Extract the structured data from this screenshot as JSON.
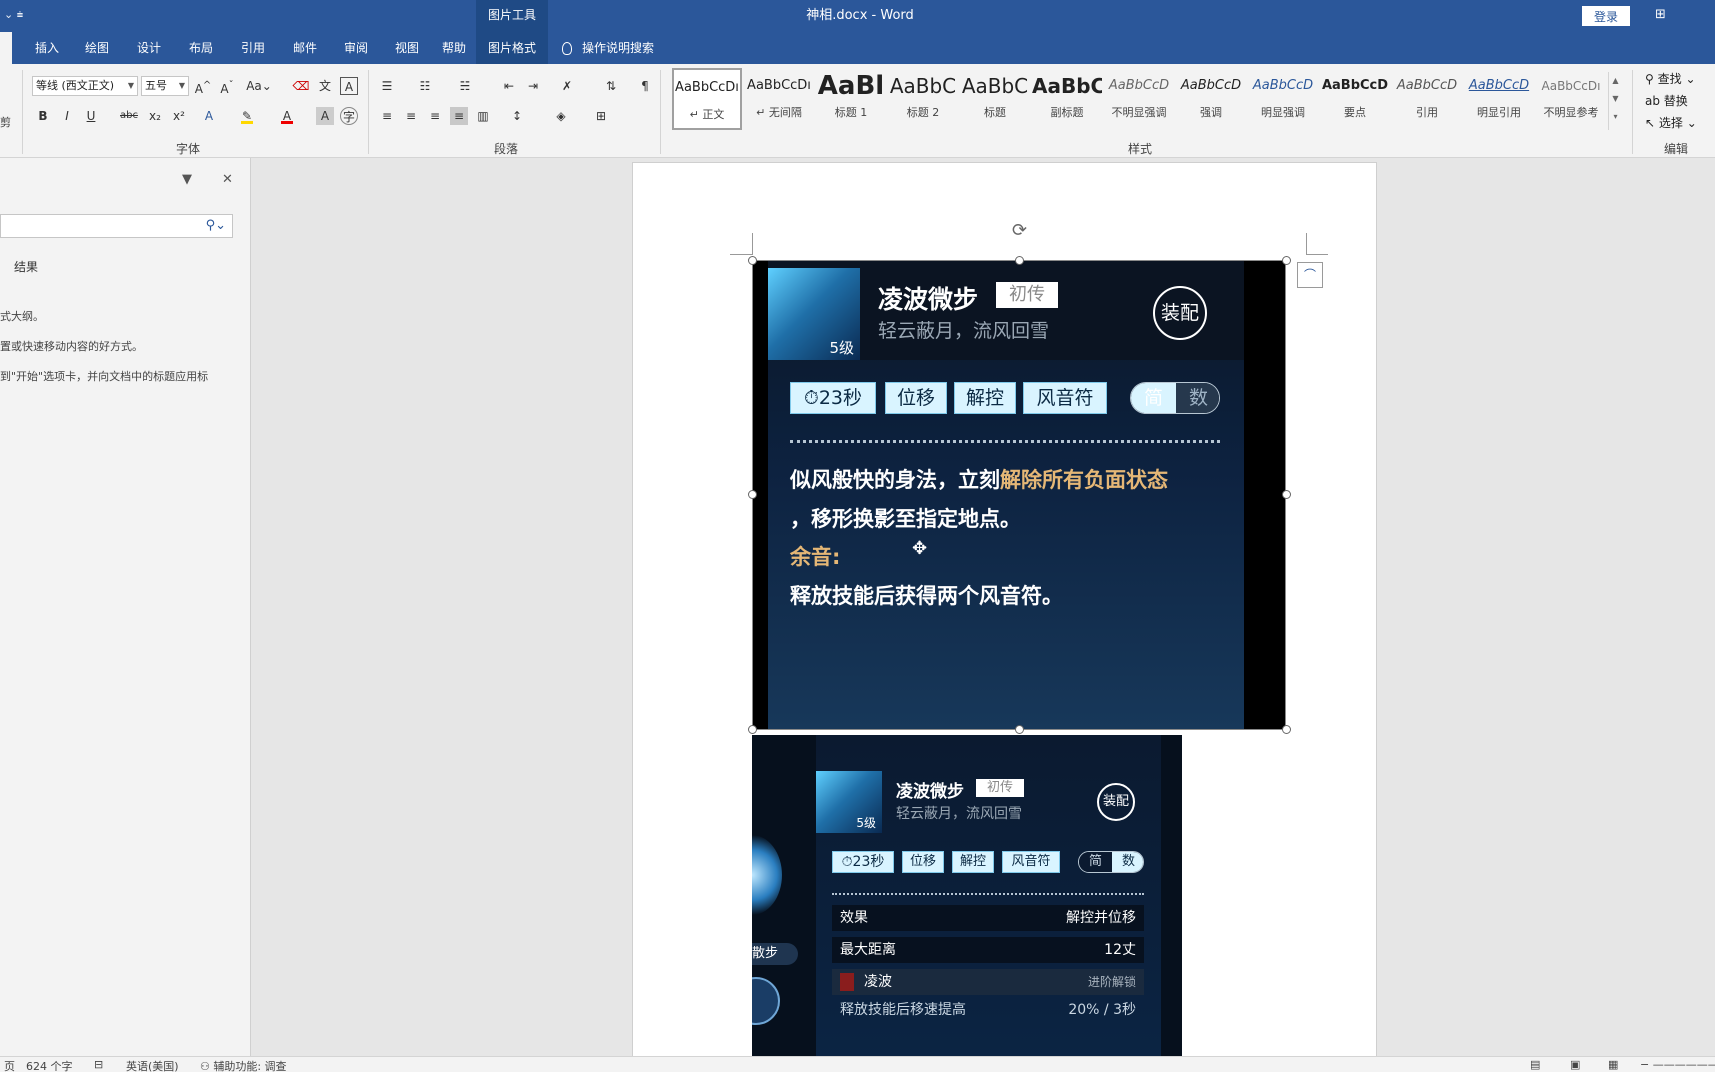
{
  "titlebar": {
    "qat": "⌄  ⩧",
    "context_tools": "图片工具",
    "doc_title": "神相.docx  -  Word",
    "login": "登录",
    "ribbon_display": "⊞"
  },
  "tabs": [
    {
      "label": "插入"
    },
    {
      "label": "绘图"
    },
    {
      "label": "设计"
    },
    {
      "label": "布局"
    },
    {
      "label": "引用"
    },
    {
      "label": "邮件"
    },
    {
      "label": "审阅"
    },
    {
      "label": "视图"
    },
    {
      "label": "帮助"
    },
    {
      "label": "图片格式"
    }
  ],
  "tell_me": "操作说明搜索",
  "ribbon": {
    "clipboard_tail": "剪",
    "font_name": "等线 (西文正文)",
    "font_size": "五号",
    "group_font": "字体",
    "group_paragraph": "段落",
    "group_styles": "样式",
    "group_editing": "编辑",
    "styles": [
      {
        "sample": "AaBbCcDı",
        "name": "↵ 正文"
      },
      {
        "sample": "AaBbCcDı",
        "name": "↵ 无间隔"
      },
      {
        "sample": "AaBl",
        "name": "标题 1"
      },
      {
        "sample": "AaBbC",
        "name": "标题 2"
      },
      {
        "sample": "AaBbC",
        "name": "标题"
      },
      {
        "sample": "AaBbC",
        "name": "副标题"
      },
      {
        "sample": "AaBbCcD",
        "name": "不明显强调"
      },
      {
        "sample": "AaBbCcD",
        "name": "强调"
      },
      {
        "sample": "AaBbCcD",
        "name": "明显强调"
      },
      {
        "sample": "AaBbCcD",
        "name": "要点"
      },
      {
        "sample": "AaBbCcD",
        "name": "引用"
      },
      {
        "sample": "AaBbCcD",
        "name": "明显引用"
      },
      {
        "sample": "AaBbCcDı",
        "name": "不明显参考"
      }
    ],
    "editing": {
      "find": "查找",
      "replace": "替换",
      "select": "选择"
    }
  },
  "navpane": {
    "results_tab": "结果",
    "hint_lines": [
      "式大纲。",
      "置或快速移动内容的好方式。",
      "到\"开始\"选项卡，并向文档中的标题应用标"
    ]
  },
  "image1": {
    "level": "5级",
    "skill_name": "凌波微步",
    "badge": "初传",
    "subtitle": "轻云蔽月，流风回雪",
    "equip": "装配",
    "tags": [
      "23秒",
      "位移",
      "解控",
      "风音符"
    ],
    "toggle": [
      "简",
      "数"
    ],
    "desc_line1_a": "似风般快的身法，立刻",
    "desc_line1_b": "解除所有负面状态",
    "desc_line2": "，移形换影至指定地点。",
    "desc_echo": "余音:",
    "desc_line4": "释放技能后获得两个风音符。"
  },
  "image2": {
    "level": "5级",
    "skill_name": "凌波微步",
    "badge": "初传",
    "subtitle": "轻云蔽月，流风回雪",
    "equip": "装配",
    "tags": [
      "23秒",
      "位移",
      "解控",
      "风音符"
    ],
    "toggle": [
      "简",
      "数"
    ],
    "side_label": "散步",
    "rows": [
      {
        "k": "效果",
        "v": "解控并位移"
      },
      {
        "k": "最大距离",
        "v": "12丈"
      },
      {
        "k": "凌波",
        "v": "进阶解锁"
      },
      {
        "k": "释放技能后移速提高",
        "v": "20% / 3秒"
      }
    ]
  },
  "statusbar": {
    "word_count": "624 个字",
    "language": "英语(美国)",
    "accessibility": "辅助功能: 调查"
  },
  "colors": {
    "ribbon_blue": "#2b579a",
    "gold_text": "#e5b776",
    "tag_bg": "#d9f4ff"
  }
}
